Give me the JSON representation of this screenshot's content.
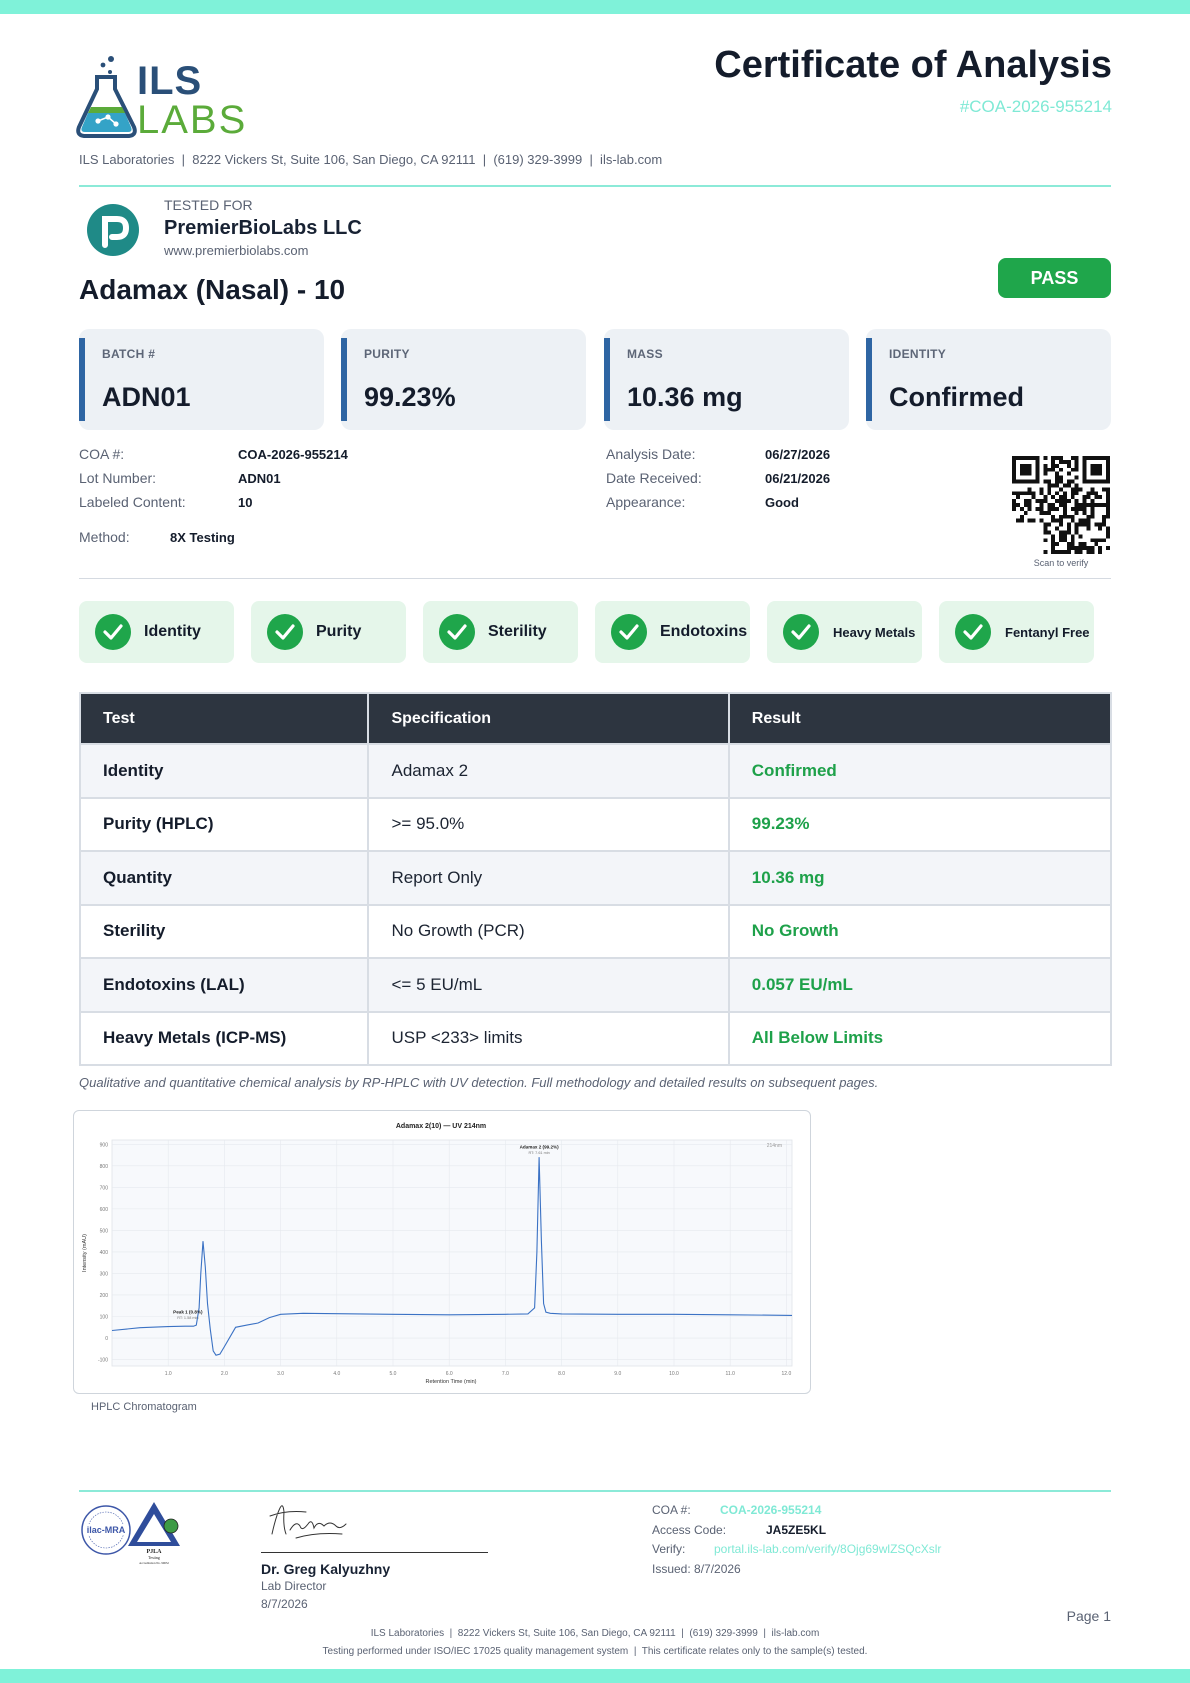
{
  "header": {
    "logo_text_1": "ILS",
    "logo_text_2": "LABS",
    "title": "Certificate of Analysis",
    "coa_tag": "#COA-2026-955214",
    "lab_line": "ILS Laboratories  |  8222 Vickers St, Suite 106, San Diego, CA 92111  |  (619) 329-3999  |  ils-lab.com"
  },
  "client": {
    "tested_for_label": "TESTED FOR",
    "name": "PremierBioLabs LLC",
    "url": "www.premierbiolabs.com"
  },
  "product": {
    "title": "Adamax (Nasal) - 10",
    "status": "PASS"
  },
  "stats": [
    {
      "label": "BATCH #",
      "value": "ADN01"
    },
    {
      "label": "PURITY",
      "value": "99.23%"
    },
    {
      "label": "MASS",
      "value": "10.36 mg"
    },
    {
      "label": "IDENTITY",
      "value": "Confirmed"
    }
  ],
  "info_left": [
    {
      "label": "COA #:",
      "value": "COA-2026-955214"
    },
    {
      "label": "Lot Number:",
      "value": "ADN01"
    },
    {
      "label": "Labeled Content:",
      "value": "10"
    }
  ],
  "info_right": [
    {
      "label": "Analysis Date:",
      "value": "06/27/2026"
    },
    {
      "label": "Date Received:",
      "value": "06/21/2026"
    },
    {
      "label": "Appearance:",
      "value": "Good"
    }
  ],
  "method": {
    "label": "Method:",
    "value": "8X Testing"
  },
  "qr_caption": "Scan to verify",
  "checks": [
    "Identity",
    "Purity",
    "Sterility",
    "Endotoxins",
    "Heavy Metals",
    "Fentanyl Free"
  ],
  "results_table": {
    "headers": [
      "Test",
      "Specification",
      "Result"
    ],
    "rows": [
      [
        "Identity",
        "Adamax 2",
        "Confirmed"
      ],
      [
        "Purity (HPLC)",
        ">= 95.0%",
        "99.23%"
      ],
      [
        "Quantity",
        "Report Only",
        "10.36 mg"
      ],
      [
        "Sterility",
        "No Growth (PCR)",
        "No Growth"
      ],
      [
        "Endotoxins (LAL)",
        "<= 5 EU/mL",
        "0.057 EU/mL"
      ],
      [
        "Heavy Metals (ICP-MS)",
        "USP <233> limits",
        "All Below Limits"
      ]
    ]
  },
  "note": "Qualitative and quantitative chemical analysis by RP-HPLC with UV detection. Full methodology and detailed results on subsequent pages.",
  "chart_caption": "HPLC Chromatogram",
  "chart_data": {
    "type": "line",
    "title": "Adamax 2(10) — UV 214nm",
    "xlabel": "Retention Time (min)",
    "ylabel": "Intensity (mAU)",
    "corner_label": "214nm",
    "xlim": [
      0,
      12.1
    ],
    "ylim": [
      -130,
      920
    ],
    "xticks": [
      1.0,
      2.0,
      3.0,
      4.0,
      5.0,
      6.0,
      7.0,
      8.0,
      9.0,
      10.0,
      11.0,
      12.0
    ],
    "yticks": [
      -100,
      0,
      100,
      200,
      300,
      400,
      500,
      600,
      700,
      800,
      900
    ],
    "grid": true,
    "series": [
      {
        "color": "#3b72c4",
        "x": [
          0.0,
          0.5,
          1.0,
          1.3,
          1.45,
          1.5,
          1.55,
          1.58,
          1.62,
          1.66,
          1.7,
          1.75,
          1.8,
          1.85,
          1.92,
          2.0,
          2.2,
          2.4,
          2.6,
          2.8,
          3.0,
          3.4,
          4.0,
          5.0,
          6.0,
          7.0,
          7.4,
          7.52,
          7.56,
          7.6,
          7.64,
          7.68,
          7.72,
          7.8,
          8.0,
          9.0,
          10.0,
          11.0,
          12.1
        ],
        "y": [
          35,
          48,
          53,
          55,
          55,
          60,
          140,
          300,
          450,
          330,
          160,
          40,
          -60,
          -80,
          -75,
          -40,
          50,
          60,
          70,
          95,
          110,
          115,
          113,
          110,
          108,
          110,
          112,
          140,
          400,
          840,
          450,
          160,
          120,
          115,
          112,
          110,
          110,
          108,
          105
        ]
      }
    ],
    "annotations": [
      {
        "x": 1.35,
        "y": 115,
        "label": "Peak 1 (0.8%)",
        "sub": "RT: 1.58 min"
      },
      {
        "x": 7.6,
        "y": 880,
        "label": "Adamax 2 (99.2%)",
        "sub": "RT: 7.61 min"
      }
    ]
  },
  "signature": {
    "name": "Dr. Greg Kalyuzhny",
    "role": "Lab Director",
    "date": "8/7/2026"
  },
  "verification": {
    "coa_label": "COA #:",
    "coa_value": "COA-2026-955214",
    "access_label": "Access Code:",
    "access_value": "JA5ZE5KL",
    "verify_label": "Verify:",
    "verify_value": "portal.ils-lab.com/verify/8Ojg69wlZSQcXslr",
    "issued": "Issued: 8/7/2026"
  },
  "footer": {
    "page": "Page 1",
    "line1": "ILS Laboratories  |  8222 Vickers St, Suite 106, San Diego, CA 92111  |  (619) 329-3999  |  ils-lab.com",
    "line2": "Testing performed under ISO/IEC 17025 quality management system  |  This certificate relates only to the sample(s) tested."
  },
  "colors": {
    "accent_teal": "#7fe9d5",
    "pass_green": "#1fa64b",
    "stat_accent": "#2e65a3",
    "table_header": "#2d3540"
  }
}
